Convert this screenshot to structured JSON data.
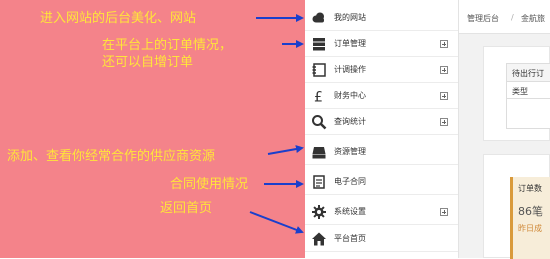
{
  "annotations": [
    "进入网站的后台美化、网站",
    "在平台上的订单情况，",
    "还可以自增订单",
    "添加、查看你经常合作的供应商资源",
    "合同使用情况",
    "返回首页"
  ],
  "sidebar": {
    "items": [
      {
        "label": "我的网站",
        "icon": "cloud-icon",
        "expandable": false
      },
      {
        "label": "订单管理",
        "icon": "server-icon",
        "expandable": true
      },
      {
        "label": "计调操作",
        "icon": "notebook-icon",
        "expandable": true
      },
      {
        "label": "财务中心",
        "icon": "pound-icon",
        "expandable": true
      },
      {
        "label": "查询统计",
        "icon": "search-icon",
        "expandable": true
      },
      {
        "label": "资源管理",
        "icon": "database-icon",
        "expandable": false
      },
      {
        "label": "电子合同",
        "icon": "contract-icon",
        "expandable": false
      },
      {
        "label": "系统设置",
        "icon": "gear-icon",
        "expandable": true
      },
      {
        "label": "平台首页",
        "icon": "home-icon",
        "expandable": false
      }
    ]
  },
  "breadcrumb": {
    "items": [
      "管理后台",
      "/",
      "金航旅"
    ]
  },
  "pending_table": {
    "header": "待出行订",
    "column": "类型"
  },
  "order_stats": {
    "title": "订单数",
    "count": "86笔",
    "sub": "昨日成"
  },
  "colors": {
    "annotation_bg": "#f4838a",
    "annotation_text": "#ffe53a",
    "arrow": "#1a3fcc",
    "stat_accent": "#d99a3b"
  }
}
